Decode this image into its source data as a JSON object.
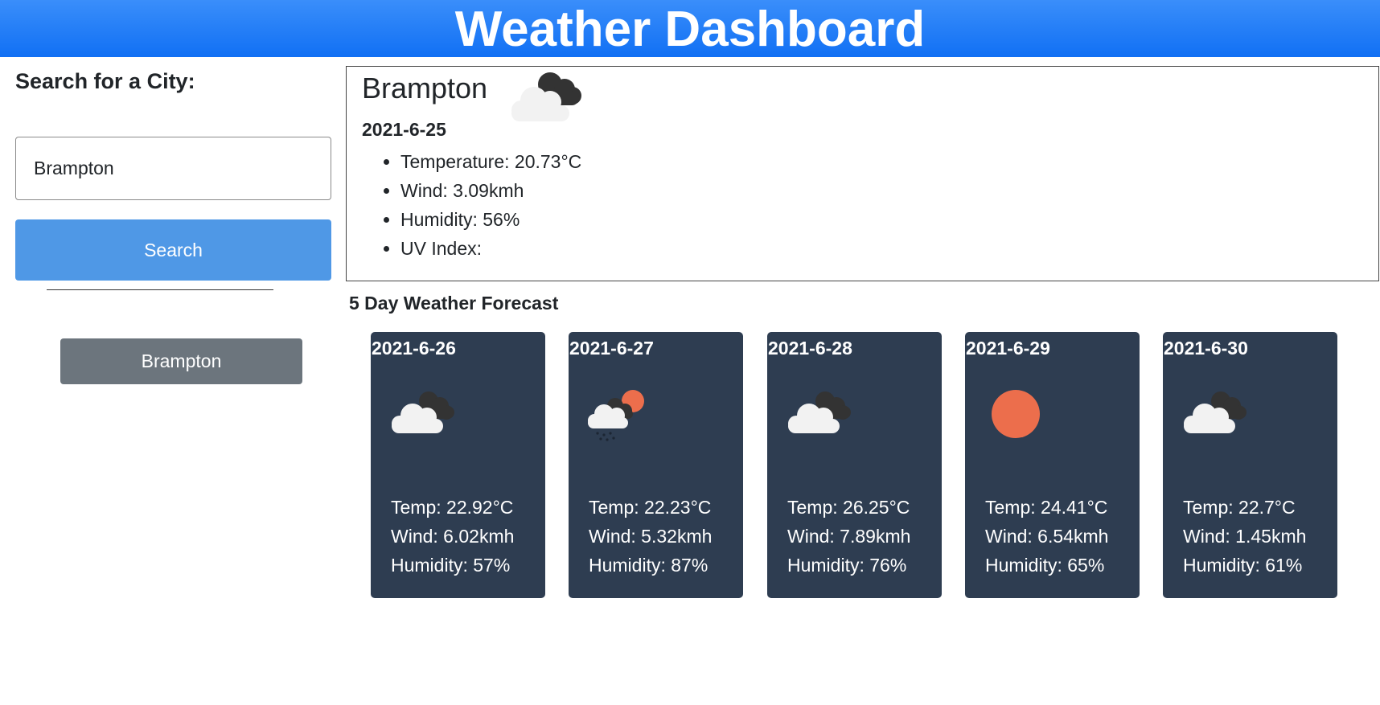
{
  "header": {
    "title": "Weather Dashboard"
  },
  "sidebar": {
    "search_label": "Search for a City:",
    "input_value": "Brampton",
    "search_button": "Search",
    "history": [
      "Brampton"
    ]
  },
  "current": {
    "city": "Brampton",
    "date": "2021-6-25",
    "icon": "cloudy-icon",
    "details": [
      "Temperature: 20.73°C",
      "Wind: 3.09kmh",
      "Humidity: 56%",
      "UV Index:"
    ]
  },
  "forecast": {
    "heading": "5 Day Weather Forecast",
    "days": [
      {
        "date": "2021-6-26",
        "icon": "cloudy-icon",
        "temp": "Temp: 22.92°C",
        "wind": "Wind: 6.02kmh",
        "humidity": "Humidity: 57%"
      },
      {
        "date": "2021-6-27",
        "icon": "rain-sun-icon",
        "temp": "Temp: 22.23°C",
        "wind": "Wind: 5.32kmh",
        "humidity": "Humidity: 87%"
      },
      {
        "date": "2021-6-28",
        "icon": "cloudy-icon",
        "temp": "Temp: 26.25°C",
        "wind": "Wind: 7.89kmh",
        "humidity": "Humidity: 76%"
      },
      {
        "date": "2021-6-29",
        "icon": "sun-icon",
        "temp": "Temp: 24.41°C",
        "wind": "Wind: 6.54kmh",
        "humidity": "Humidity: 65%"
      },
      {
        "date": "2021-6-30",
        "icon": "cloudy-icon",
        "temp": "Temp: 22.7°C",
        "wind": "Wind: 1.45kmh",
        "humidity": "Humidity: 61%"
      }
    ]
  },
  "colors": {
    "header_blue": "#1170f4",
    "search_button": "#4f98e6",
    "history_button": "#6c757d",
    "card_bg": "#2e3d51",
    "sun": "#ec6e4c"
  }
}
